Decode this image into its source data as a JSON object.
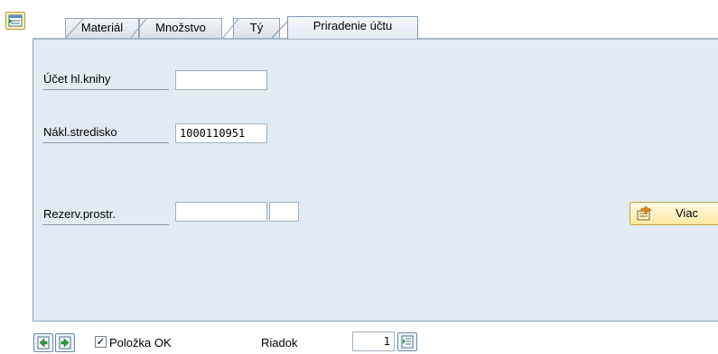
{
  "tabs": [
    {
      "label": "Materiál",
      "active": false
    },
    {
      "label": "Množstvo",
      "active": false
    },
    {
      "label": "Tý",
      "active": false
    },
    {
      "label": "Priradenie účtu",
      "active": true
    }
  ],
  "form": {
    "gl_account": {
      "label": "Účet hl.knihy",
      "value": ""
    },
    "cost_center": {
      "label": "Nákl.stredisko",
      "value": "1000110951"
    },
    "funds_reservation": {
      "label": "Rezerv.prostr.",
      "value": "",
      "item_value": ""
    }
  },
  "more_button": {
    "label": "Viac",
    "icon": "document-arrow-icon"
  },
  "footer": {
    "item_ok": {
      "label": "Položka OK",
      "checked": true,
      "mark": "✓"
    },
    "row": {
      "label": "Riadok",
      "value": "1"
    }
  },
  "colors": {
    "panel": "#e2ebf3",
    "tab_border": "#94a5b8",
    "button_yellow": "#fde89f"
  }
}
